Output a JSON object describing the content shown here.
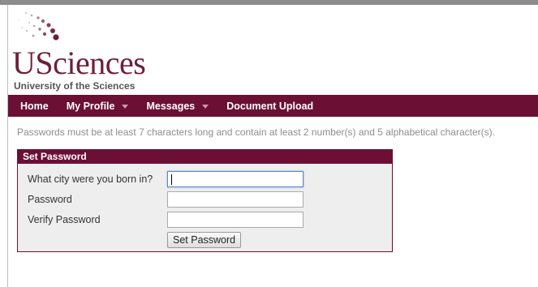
{
  "logo": {
    "wordmark": "USciences",
    "subtitle": "University of the Sciences",
    "brand_color": "#6b0f35"
  },
  "nav": {
    "items": [
      {
        "label": "Home",
        "has_dropdown": false
      },
      {
        "label": "My Profile",
        "has_dropdown": true
      },
      {
        "label": "Messages",
        "has_dropdown": true
      },
      {
        "label": "Document Upload",
        "has_dropdown": false
      }
    ],
    "background": "#6b0f35"
  },
  "notice": {
    "text": "Passwords must be at least 7 characters long and contain at least 2 number(s) and 5 alphabetical character(s)."
  },
  "panel": {
    "title": "Set Password",
    "fields": [
      {
        "label": "What city were you born in?",
        "value": "",
        "type": "text",
        "focused": true
      },
      {
        "label": "Password",
        "value": "",
        "type": "password",
        "focused": false
      },
      {
        "label": "Verify Password",
        "value": "",
        "type": "password",
        "focused": false
      }
    ],
    "submit_label": "Set Password"
  }
}
